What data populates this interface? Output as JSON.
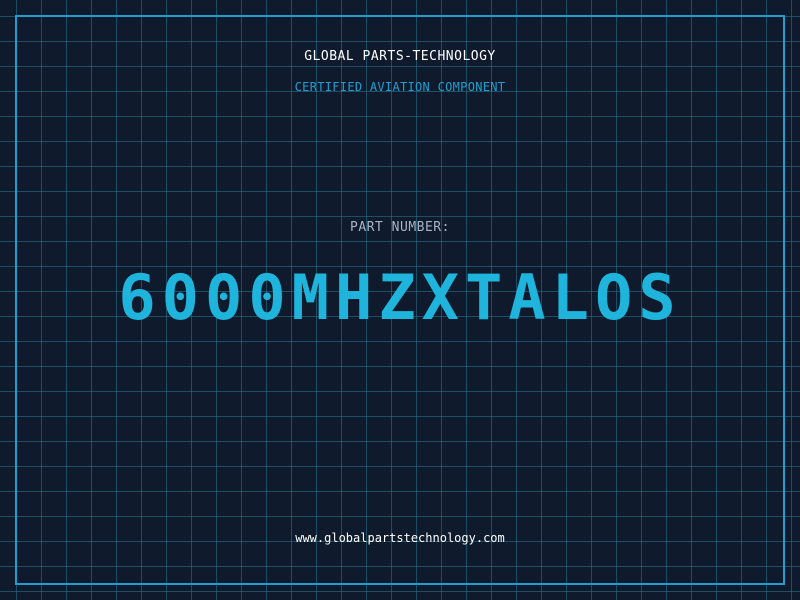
{
  "header": {
    "company": "GLOBAL PARTS-TECHNOLOGY",
    "certification": "CERTIFIED AVIATION COMPONENT"
  },
  "part": {
    "label": "PART NUMBER:",
    "number": "6000MHZXTALOS"
  },
  "footer": {
    "url": "www.globalpartstechnology.com"
  },
  "colors": {
    "background": "#0f1b2d",
    "grid": "#28789a",
    "frame": "#1e9fd0",
    "accent": "#1eb4dc"
  }
}
